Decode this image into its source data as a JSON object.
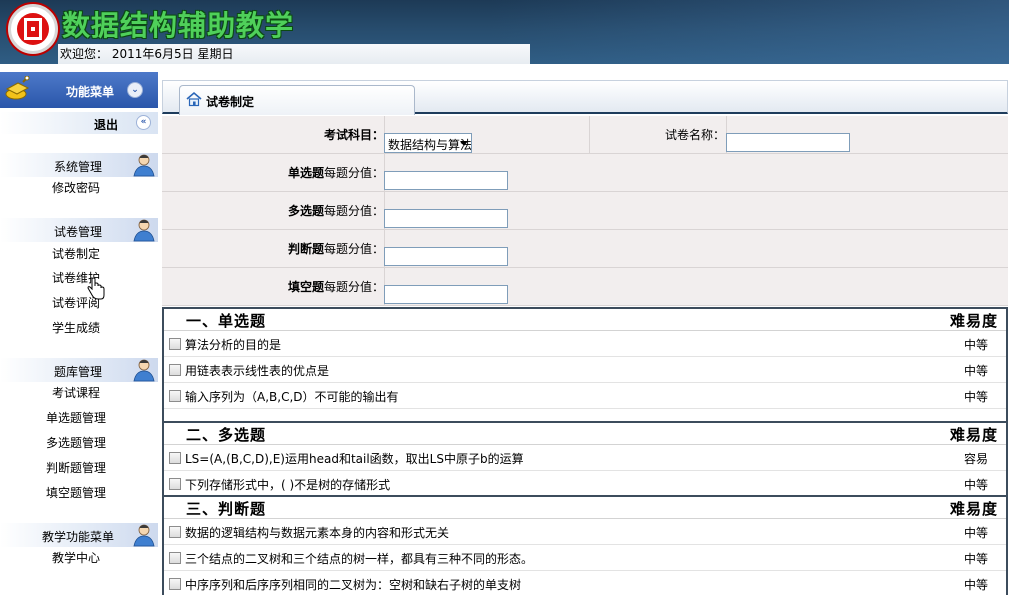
{
  "header": {
    "app_title": "数据结构辅助教学",
    "welcome": "欢迎您： 2011年6月5日 星期日"
  },
  "sidebar": {
    "menu_title": "功能菜单",
    "logout_label": "退出",
    "groups": [
      {
        "title": "系统管理",
        "items": [
          "修改密码"
        ]
      },
      {
        "title": "试卷管理",
        "items": [
          "试卷制定",
          "试卷维护",
          "试卷评阅",
          "学生成绩"
        ]
      },
      {
        "title": "题库管理",
        "items": [
          "考试课程",
          "单选题管理",
          "多选题管理",
          "判断题管理",
          "填空题管理"
        ]
      },
      {
        "title": "教学功能菜单",
        "items": [
          "教学中心"
        ]
      }
    ]
  },
  "tab": {
    "label": "试卷制定"
  },
  "form": {
    "subject_label": "考试科目：",
    "subject_value": "数据结构与算法",
    "paper_name_label": "试卷名称：",
    "paper_name_value": "",
    "score_rows": [
      {
        "bold": "单选题",
        "rest": "每题分值：",
        "value": ""
      },
      {
        "bold": "多选题",
        "rest": "每题分值：",
        "value": ""
      },
      {
        "bold": "判断题",
        "rest": "每题分值：",
        "value": ""
      },
      {
        "bold": "填空题",
        "rest": "每题分值：",
        "value": ""
      }
    ]
  },
  "sections": [
    {
      "title": "一、单选题",
      "difficulty_header": "难易度",
      "questions": [
        {
          "text": "算法分析的目的是",
          "level": "中等"
        },
        {
          "text": "用链表表示线性表的优点是",
          "level": "中等"
        },
        {
          "text": "输入序列为（A,B,C,D）不可能的输出有",
          "level": "中等"
        }
      ]
    },
    {
      "title": "二、多选题",
      "difficulty_header": "难易度",
      "questions": [
        {
          "text": "LS=(A,(B,C,D),E)运用head和tail函数，取出LS中原子b的运算",
          "level": "容易"
        },
        {
          "text": "下列存储形式中，( )不是树的存储形式",
          "level": "中等"
        }
      ]
    },
    {
      "title": "三、判断题",
      "difficulty_header": "难易度",
      "questions": [
        {
          "text": "数据的逻辑结构与数据元素本身的内容和形式无关",
          "level": "中等"
        },
        {
          "text": "三个结点的二叉树和三个结点的树一样，都具有三种不同的形态。",
          "level": "中等"
        },
        {
          "text": "中序序列和后序序列相同的二叉树为：空树和缺右子树的单支树",
          "level": "中等"
        }
      ]
    }
  ]
}
